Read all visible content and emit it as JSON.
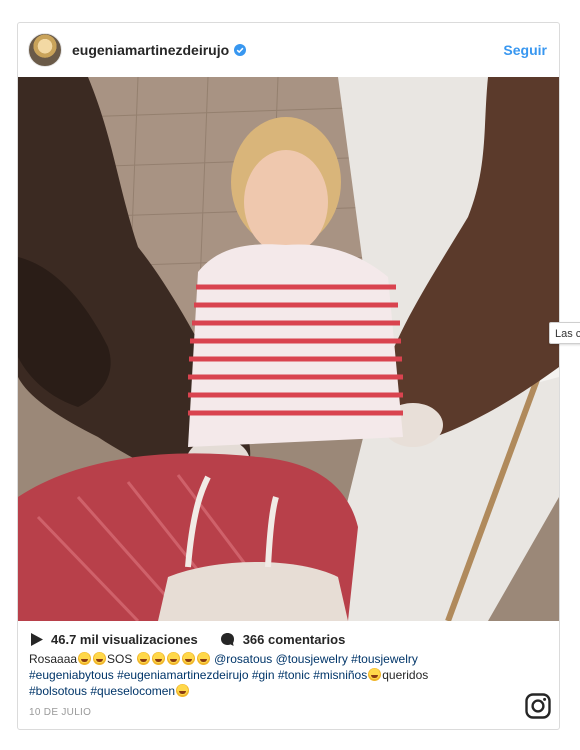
{
  "post": {
    "username": "eugeniamartinezdeirujo",
    "follow_label": "Seguir",
    "views": "46.7 mil visualizaciones",
    "comments": "366 comentarios",
    "caption": {
      "line1_a": "Rosaaaa",
      "line1_b": "SOS",
      "line1_c": "@rosatous @tousjewelry #tousjewelry",
      "line2_a": "#eugeniabytous #eugeniamartinezdeirujo #gin #tonic #misniños",
      "line2_b": "queridos",
      "line3": "#bolsotous #queselocomen"
    },
    "date": "10 DE JULIO"
  },
  "side_tab": {
    "label": "Las c"
  },
  "colors": {
    "link_blue": "#3897f0",
    "tag_blue": "#003569",
    "border": "#dbdbdb",
    "muted": "#999999"
  },
  "icons": [
    "verified-badge-icon",
    "play-icon",
    "comment-bubble-icon",
    "instagram-logo-icon"
  ]
}
